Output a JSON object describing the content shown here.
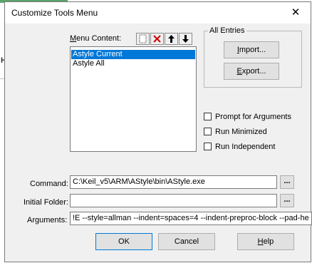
{
  "background": {
    "glyph": "H"
  },
  "window": {
    "title": "Customize Tools Menu",
    "close_glyph": "✕"
  },
  "menu_content": {
    "label_accel": "M",
    "label_rest": "enu Content:",
    "items": [
      {
        "label": "Astyle Current",
        "selected": true
      },
      {
        "label": "Astyle All",
        "selected": false
      }
    ],
    "toolbar": [
      "new-icon",
      "delete-icon",
      "move-up-icon",
      "move-down-icon"
    ]
  },
  "all_entries": {
    "title": "All Entries",
    "import_accel": "I",
    "import_rest": "mport...",
    "export_accel": "E",
    "export_rest": "xport..."
  },
  "options": [
    {
      "label": "Prompt for  Arguments",
      "checked": false
    },
    {
      "label": "Run Minimized",
      "checked": false
    },
    {
      "label": "Run Independent",
      "checked": false
    }
  ],
  "fields": {
    "command": {
      "label": "Command:",
      "value": "C:\\Keil_v5\\ARM\\AStyle\\bin\\AStyle.exe",
      "browse": "..."
    },
    "initial_folder": {
      "label": "Initial Folder:",
      "value": "",
      "browse": "..."
    },
    "arguments": {
      "label": "Arguments:",
      "value": "!E --style=allman --indent=spaces=4 --indent-preproc-block --pad-he"
    }
  },
  "buttons": {
    "ok": "OK",
    "cancel": "Cancel",
    "help_accel": "H",
    "help_rest": "elp"
  },
  "colors": {
    "selection": "#0078d7",
    "dialog_bg": "#f0f0f0",
    "delete_icon": "#d00000"
  }
}
